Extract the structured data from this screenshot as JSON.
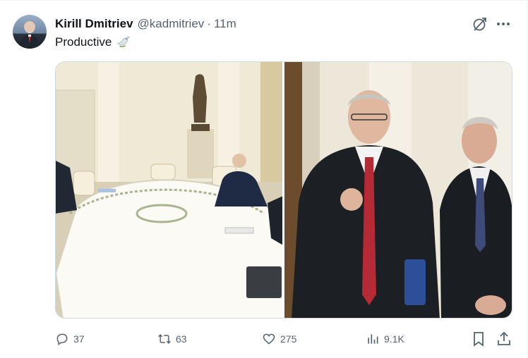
{
  "tweet": {
    "author_name": "Kirill Dmitriev",
    "author_handle": "@kadmitriev",
    "separator": "·",
    "time": "11m",
    "text": "Productive",
    "emoji_icon": "dove-icon",
    "media": [
      {
        "label": "Meeting room with oval conference table"
      },
      {
        "label": "Two men in suits walking in hall"
      }
    ]
  },
  "actions": {
    "replies": "37",
    "reposts": "63",
    "likes": "275",
    "views": "9.1K"
  },
  "icons": {
    "reply": "reply-icon",
    "repost": "repost-icon",
    "like": "like-icon",
    "views": "views-icon",
    "bookmark": "bookmark-icon",
    "share": "share-icon",
    "grok": "grok-icon",
    "more": "more-icon"
  },
  "colors": {
    "text_primary": "#0f1419",
    "text_secondary": "#536471",
    "border": "#cfd9de"
  }
}
